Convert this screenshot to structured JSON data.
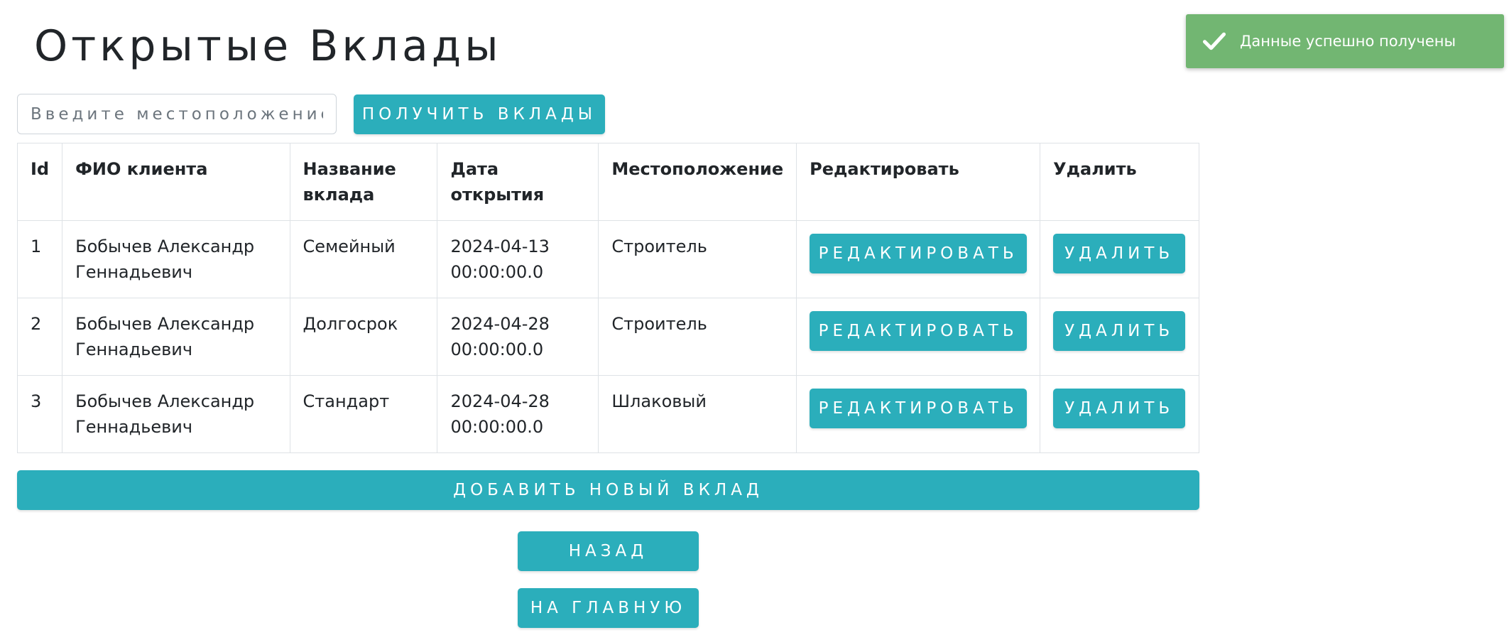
{
  "page": {
    "title": "Открытые Вклады"
  },
  "search": {
    "placeholder": "Введите местоположение",
    "value": ""
  },
  "buttons": {
    "get_deposits": "ПОЛУЧИТЬ ВКЛАДЫ",
    "add_deposit": "ДОБАВИТЬ НОВЫЙ ВКЛАД",
    "back": "НАЗАД",
    "home": "НА ГЛАВНУЮ",
    "edit": "РЕДАКТИРОВАТЬ",
    "delete": "УДАЛИТЬ"
  },
  "table": {
    "headers": [
      "Id",
      "ФИО клиента",
      "Название вклада",
      "Дата открытия",
      "Местоположение",
      "Редактировать",
      "Удалить"
    ],
    "rows": [
      {
        "id": "1",
        "client": "Бобычев Александр Геннадьевич",
        "name": "Семейный",
        "date": "2024-04-13 00:00:00.0",
        "location": "Строитель"
      },
      {
        "id": "2",
        "client": "Бобычев Александр Геннадьевич",
        "name": "Долгосрок",
        "date": "2024-04-28 00:00:00.0",
        "location": "Строитель"
      },
      {
        "id": "3",
        "client": "Бобычев Александр Геннадьевич",
        "name": "Стандарт",
        "date": "2024-04-28 00:00:00.0",
        "location": "Шлаковый"
      }
    ]
  },
  "toast": {
    "message": "Данные успешно получены",
    "icon": "check-icon",
    "color": "#72b672"
  },
  "colors": {
    "accent": "#2baebb",
    "border": "#dee2e6"
  }
}
